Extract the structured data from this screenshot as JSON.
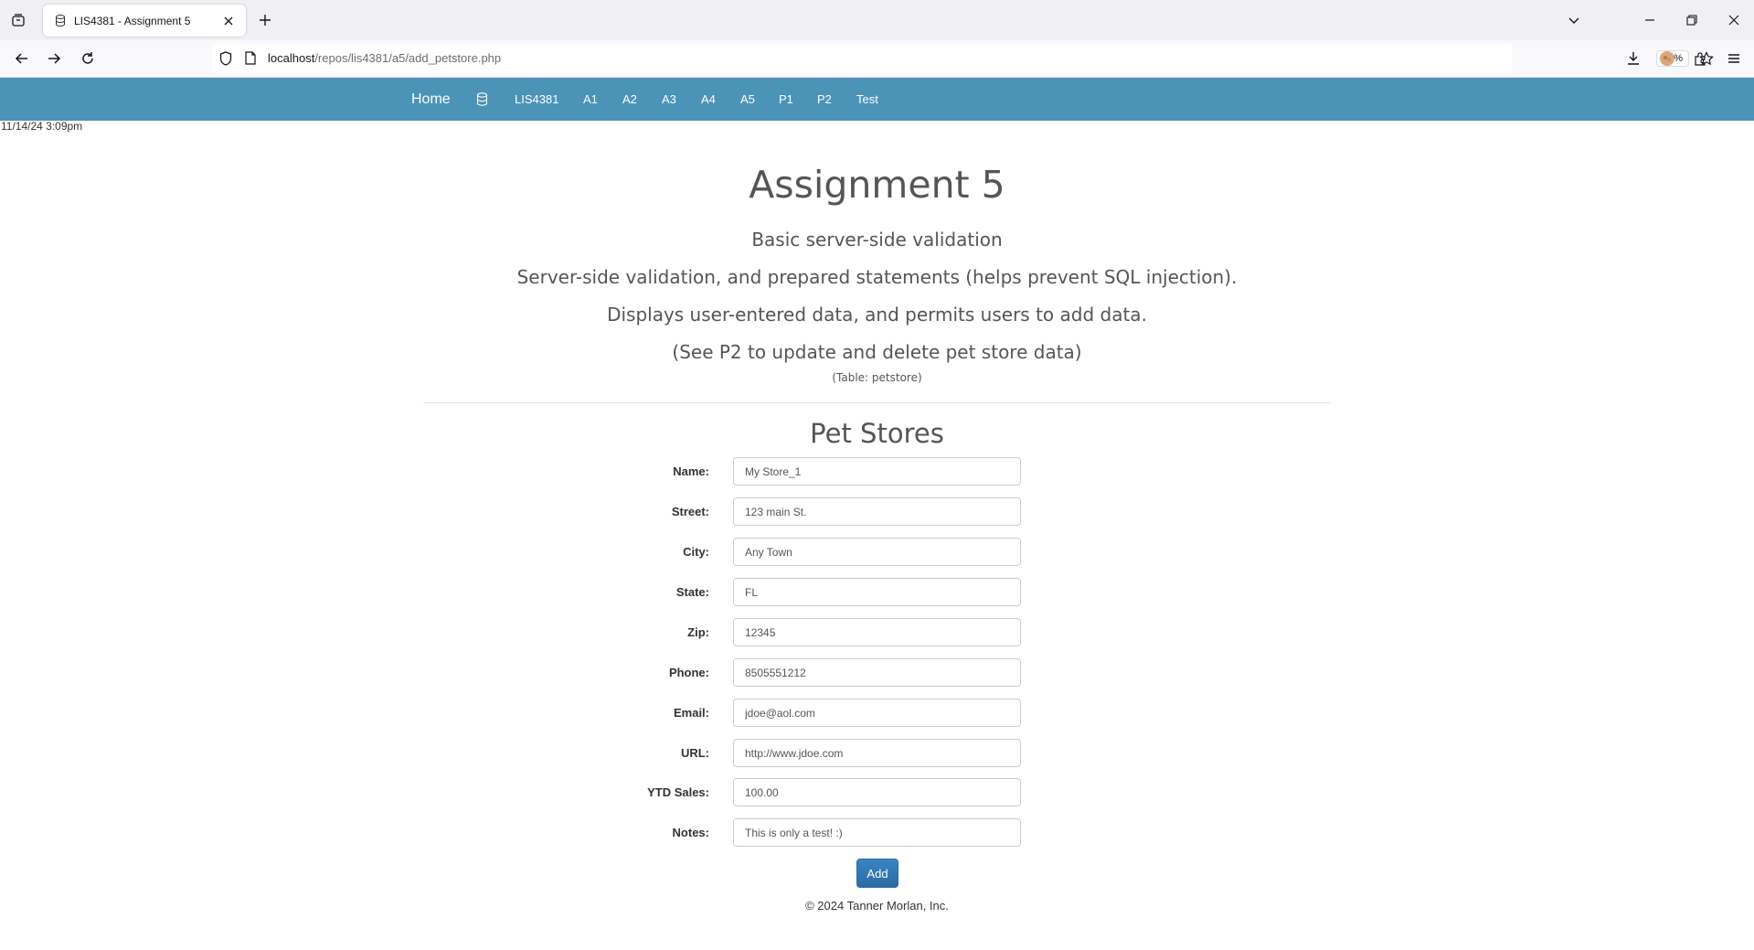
{
  "browser": {
    "tab_title": "LIS4381 - Assignment 5",
    "url_host": "localhost",
    "url_path": "/repos/lis4381/a5/add_petstore.php",
    "zoom": "90%"
  },
  "site_nav": {
    "brand": "Home",
    "items": [
      "LIS4381",
      "A1",
      "A2",
      "A3",
      "A4",
      "A5",
      "P1",
      "P2",
      "Test"
    ]
  },
  "timestamp": "11/14/24 3:09pm",
  "page": {
    "title": "Assignment 5",
    "line1": "Basic server-side validation",
    "line2": "Server-side validation, and prepared statements (helps prevent SQL injection).",
    "line3": "Displays user-entered data, and permits users to add data.",
    "line4": "(See P2 to update and delete pet store data)",
    "table_note": "(Table: petstore)"
  },
  "form": {
    "title": "Pet Stores",
    "fields": [
      {
        "label": "Name:",
        "value": "My Store_1"
      },
      {
        "label": "Street:",
        "value": "123 main St."
      },
      {
        "label": "City:",
        "value": "Any Town"
      },
      {
        "label": "State:",
        "value": "FL"
      },
      {
        "label": "Zip:",
        "value": "12345"
      },
      {
        "label": "Phone:",
        "value": "8505551212"
      },
      {
        "label": "Email:",
        "value": "jdoe@aol.com"
      },
      {
        "label": "URL:",
        "value": "http://www.jdoe.com"
      },
      {
        "label": "YTD Sales:",
        "value": "100.00"
      },
      {
        "label": "Notes:",
        "value": "This is only a test! :)"
      }
    ],
    "submit_label": "Add"
  },
  "footer": "© 2024 Tanner Morlan, Inc."
}
